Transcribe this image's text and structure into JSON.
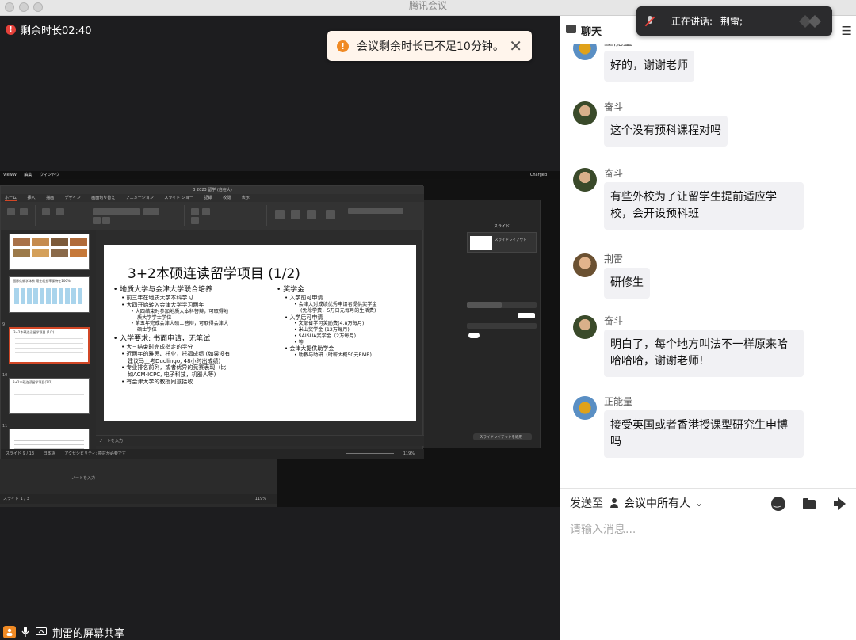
{
  "window": {
    "title": "腾讯会议"
  },
  "meeting": {
    "timer": "剩余时长02:40",
    "toast": "会议剩余时长已不足10分钟。",
    "share_label": "荆雷的屏幕共享",
    "speaking_label": "正在讲话:",
    "speaking_name": "荆雷;"
  },
  "shared_screen": {
    "mac_menu": [
      "ViewW",
      "編集",
      "ウィンドウ"
    ],
    "mac_status": "Charged",
    "ppt_window_title": "3 2023 留学 (自在大)",
    "ribbon_tabs": [
      "ホーム",
      "挿入",
      "描画",
      "デザイン",
      "画面切り替え",
      "アニメーション",
      "スライド ショー",
      "記録",
      "校閲",
      "表示"
    ],
    "thumbnails": [
      {
        "num": "",
        "title": ""
      },
      {
        "num": "",
        "title": "国际化教学体系 硕士就业率保持在100%"
      },
      {
        "num": "9",
        "title": "3+2本硕连读留学项目 (1/2)"
      },
      {
        "num": "10",
        "title": "3+2本硕连读留学项目(2/2)"
      },
      {
        "num": "11",
        "title": ""
      }
    ],
    "slide": {
      "title": "3+2本硕连读留学项目 (1/2)",
      "left": [
        {
          "level": 1,
          "text": "地质大学与会津大学联合培养"
        },
        {
          "level": 2,
          "text": "前三年在地质大学本科学习"
        },
        {
          "level": 2,
          "text": "大四开始转入会津大学学习两年"
        },
        {
          "level": 3,
          "text": "大四结束时参加地质大本科答辩，可取得地",
          "cont": "质大学学士学位"
        },
        {
          "level": 3,
          "text": "第五年完成会津大硕士答辩，可取得会津大",
          "cont": "硕士学位"
        },
        {
          "level": 1,
          "text": "入学要求: 书面申请，无笔试"
        },
        {
          "level": 2,
          "text": "大三结束时完成指定的学分"
        },
        {
          "level": 2,
          "text": "近两年的雅思、托业，托福成绩 (如果没有,",
          "cont": "建议马上考Duolingo, 48小时出成绩)"
        },
        {
          "level": 2,
          "text": "专业排名前列，或者优异的竞赛表现（比",
          "cont": "如ACM-ICPC, 电子科技，机器人等)"
        },
        {
          "level": 2,
          "text": "有会津大学的教授同意接收"
        }
      ],
      "right": [
        {
          "level": 1,
          "text": "奖学金"
        },
        {
          "level": 2,
          "text": "入学前可申请"
        },
        {
          "level": 3,
          "text": "会津大对成绩优秀申请者提供奖学金",
          "cont": "(免除学费，5万日元每月的生活费)"
        },
        {
          "level": 2,
          "text": "入学后可申请"
        },
        {
          "level": 3,
          "text": "文部省学习奖励费(4.8万每月)"
        },
        {
          "level": 3,
          "text": "米山奖学金 (12万每月)"
        },
        {
          "level": 3,
          "text": "SAISUA奖学金（2万每月)"
        },
        {
          "level": 3,
          "text": "等"
        },
        {
          "level": 2,
          "text": "会津大提供助学金"
        },
        {
          "level": 3,
          "text": "助教与助研（时薪大概50元RMB)"
        }
      ]
    },
    "notes_placeholder": "ノートを入力",
    "status_left": "スライド 9 / 13",
    "status_lang": "日本語",
    "status_access": "アクセシビリティ: 検討が必要です",
    "zoom": "119%",
    "back_status": "スライド 1 / 3",
    "back_zoom": "119%",
    "panel_title": "スライド",
    "panel_layout": "スライドレイアウト",
    "panel_btn": "スライドレイアウトを適用"
  },
  "chat": {
    "header": "聊天",
    "messages": [
      {
        "sender": "正能量",
        "text": "好的，谢谢老师",
        "avatar": "sun"
      },
      {
        "sender": "奋斗",
        "text": "这个没有预科课程对吗",
        "avatar": "p1"
      },
      {
        "sender": "奋斗",
        "text": "有些外校为了让留学生提前适应学校，会开设预科班",
        "avatar": "p1"
      },
      {
        "sender": "荆雷",
        "text": "研修生",
        "avatar": "p2"
      },
      {
        "sender": "奋斗",
        "text": "明白了，每个地方叫法不一样原来哈哈哈哈，谢谢老师!",
        "avatar": "p1"
      },
      {
        "sender": "正能量",
        "text": "接受英国或者香港授课型研究生申博吗",
        "avatar": "sun"
      }
    ],
    "send_to_label": "发送至",
    "send_to_target": "会议中所有人",
    "input_placeholder": "请输入消息..."
  },
  "colors": {
    "accent": "#d24726",
    "warning": "#f08a24",
    "danger": "#e5413a"
  }
}
